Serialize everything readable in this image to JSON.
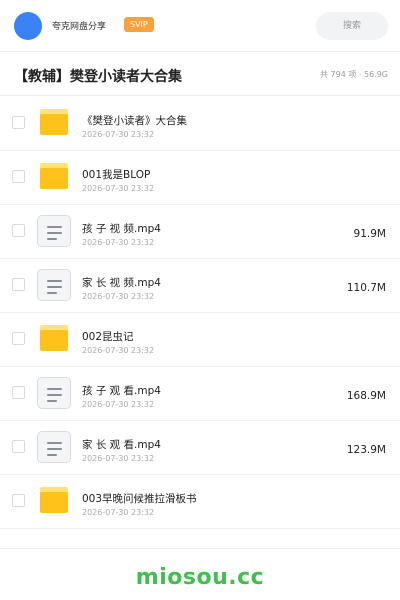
{
  "header": {
    "username": "夸克网盘分享",
    "badge": "SVIP",
    "search_placeholder": "搜索"
  },
  "share": {
    "title": "【教辅】樊登小读者大合集",
    "meta": "共 794 项 · 56.9G"
  },
  "files": [
    {
      "type": "folder",
      "name": "《樊登小读者》大合集",
      "date": "2026-07-30 23:32",
      "size": ""
    },
    {
      "type": "folder",
      "name": "001我是BLOP",
      "date": "2026-07-30 23:32",
      "size": ""
    },
    {
      "type": "file",
      "name": "孩 子 视 频.mp4",
      "date": "2026-07-30 23:32",
      "size": "91.9M"
    },
    {
      "type": "file",
      "name": "家 长 视 频.mp4",
      "date": "2026-07-30 23:32",
      "size": "110.7M"
    },
    {
      "type": "folder",
      "name": "002昆虫记",
      "date": "2026-07-30 23:32",
      "size": ""
    },
    {
      "type": "file",
      "name": "孩 子 观 看.mp4",
      "date": "2026-07-30 23:32",
      "size": "168.9M"
    },
    {
      "type": "file",
      "name": "家 长 观 看.mp4",
      "date": "2026-07-30 23:32",
      "size": "123.9M"
    },
    {
      "type": "folder",
      "name": "003早晚问候推拉滑板书",
      "date": "2026-07-30 23:32",
      "size": ""
    }
  ],
  "icons": {
    "folder": "folder-icon",
    "file": "video-file-icon",
    "avatar": "avatar"
  },
  "colors": {
    "accent": "#3b82f6",
    "badge": "#f7a23a",
    "folder": "#ffc21a",
    "watermark": "#3fbf4e"
  },
  "watermark": "miosou.cc"
}
